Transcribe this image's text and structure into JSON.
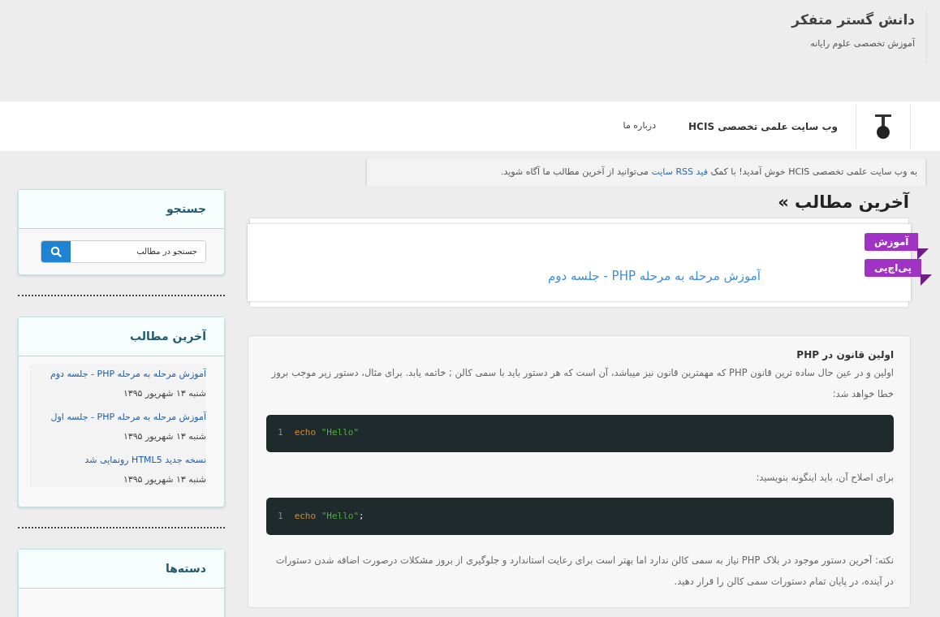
{
  "header": {
    "title": "دانش گستر متفکر",
    "tagline": "آموزش تخصصی علوم رایانه"
  },
  "navbar": {
    "brand": "وب سایت علمی تخصصی HCIS",
    "links": [
      "درباره ما"
    ]
  },
  "notice": {
    "before": "به وب سایت علمی تخصصی HCIS خوش آمدید! با کمک",
    "link": "فید RSS سایت",
    "after": "می‌توانید از آخرین مطالب ما آگاه شوید."
  },
  "main": {
    "heading": "آخرین مطالب »",
    "featured": {
      "title": "آموزش مرحله به مرحله PHP - جلسه دوم",
      "tags": [
        "آموزش",
        "پی‌اچ‌پی"
      ]
    },
    "article": {
      "heading": "اولین قانون در PHP",
      "blocks": [
        {
          "kind": "paragraph",
          "text": "اولین و در عین حال ساده ترین قانون PHP که مهمترین قانون نیز میباشد، آن است که هر دستور باید با سمی کالن ; خاتمه یابد. برای مثال، دستور زیر موجب بروز خطا خواهد شد:"
        },
        {
          "kind": "code",
          "line": "1",
          "keyword": "echo",
          "string": "\"Hello\""
        },
        {
          "kind": "paragraph",
          "text": "برای اصلاح آن، باید اینگونه بنویسید:"
        },
        {
          "kind": "code",
          "line": "1",
          "keyword": "echo",
          "string": "\"Hello\"",
          "tail": ";"
        },
        {
          "kind": "paragraph",
          "text": "نکته: آخرین دستور موجود در بلاک PHP نیاز به سمی کالن ندارد اما بهتر است برای رعایت استاندارد و جلوگیری از بروز مشکلات درصورت اضافه شدن دستورات در آینده، در پایان تمام دستورات سمی کالن را قرار دهید."
        }
      ]
    }
  },
  "sidebar": [
    {
      "kind": "search",
      "title": "جستجو",
      "placeholder": "جستجو در مطالب"
    },
    {
      "kind": "posts",
      "title": "آخرین مطالب",
      "items": [
        {
          "title": "آموزش مرحله به مرحله PHP - جلسه دوم",
          "date": "شنبه ۱۳ شهریور ۱۳۹۵"
        },
        {
          "title": "آموزش مرحله به مرحله PHP - جلسه اول",
          "date": "شنبه ۱۳ شهریور ۱۳۹۵"
        },
        {
          "title": "نسخه جدید HTML5 رونمایی شد",
          "date": "شنبه ۱۳ شهریور ۱۳۹۵"
        }
      ]
    },
    {
      "kind": "categories",
      "title": "دسته‌ها"
    }
  ]
}
